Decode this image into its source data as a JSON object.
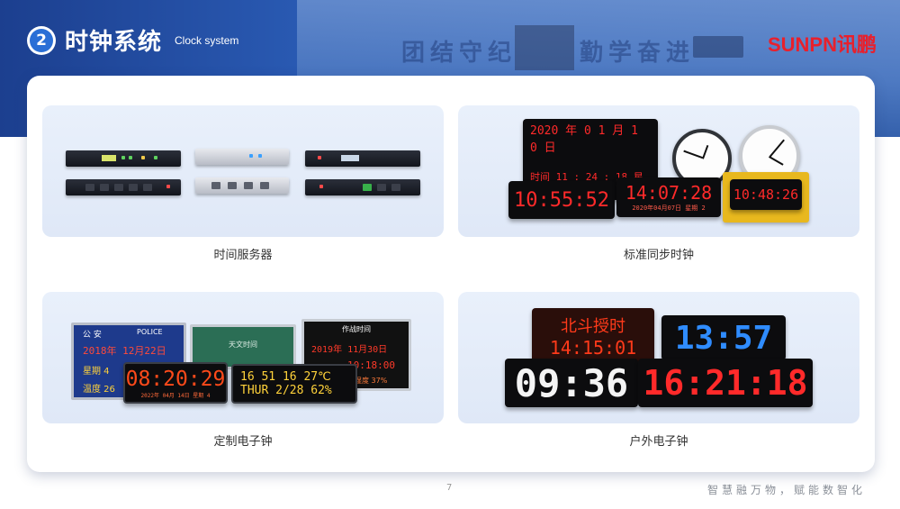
{
  "header": {
    "section_number": "2",
    "title_cn": "时钟系统",
    "title_en": "Clock system",
    "brand": "SUNPN讯鹏",
    "background_wall_text_left": "团结守纪",
    "background_wall_text_right": "勤学奋进"
  },
  "panels": [
    {
      "caption": "时间服务器",
      "icon": "rack-server-image"
    },
    {
      "caption": "标准同步时钟",
      "icon": "sync-clock-image",
      "displays": {
        "date_line": "2020 年 0 1 月 1 0 日",
        "time_line": "时间 11 : 24 : 18 星期 5",
        "clock_a": "10:55:52",
        "clock_b": "14:07:28",
        "clock_b_sub": "2020年04月07日    星期 2",
        "clock_c": "10:48:26"
      }
    },
    {
      "caption": "定制电子钟",
      "icon": "custom-clock-image",
      "displays": {
        "police_header": "公 安",
        "police_badge": "POLICE",
        "police_date": "2018年 12月22日",
        "police_week": "星期 4",
        "police_temp": "温度 26",
        "green_title": "天文时间",
        "battle_title": "作战时间",
        "battle_date": "2019年 11月30日",
        "battle_time": "10:18:00",
        "battle_humidity": "湿度 37%",
        "main_time": "08:20:29",
        "sub_line": "2022年 04月 14日  星期 4",
        "multi_line1": "16  51  16   27℃",
        "multi_line2": "THUR  2/28   62%"
      }
    },
    {
      "caption": "户外电子钟",
      "icon": "outdoor-clock-image",
      "displays": {
        "beidou_title": "北斗授时",
        "beidou_time": "14:15:01",
        "blue_time": "13:57",
        "white_time": "09:36",
        "red_time": "16:21:18"
      }
    }
  ],
  "footer": {
    "page_number": "7",
    "slogan": "智慧融万物，赋能数智化"
  },
  "colors": {
    "banner": "#2a5bb4",
    "brand_red": "#e8202c",
    "accent_blue": "#2a6fd6",
    "panel_bg": "#e6eefa",
    "led_red": "#ff2a2a",
    "led_blue": "#2f8cff",
    "led_green": "#4cff7a",
    "led_white": "#f4f4f4"
  }
}
